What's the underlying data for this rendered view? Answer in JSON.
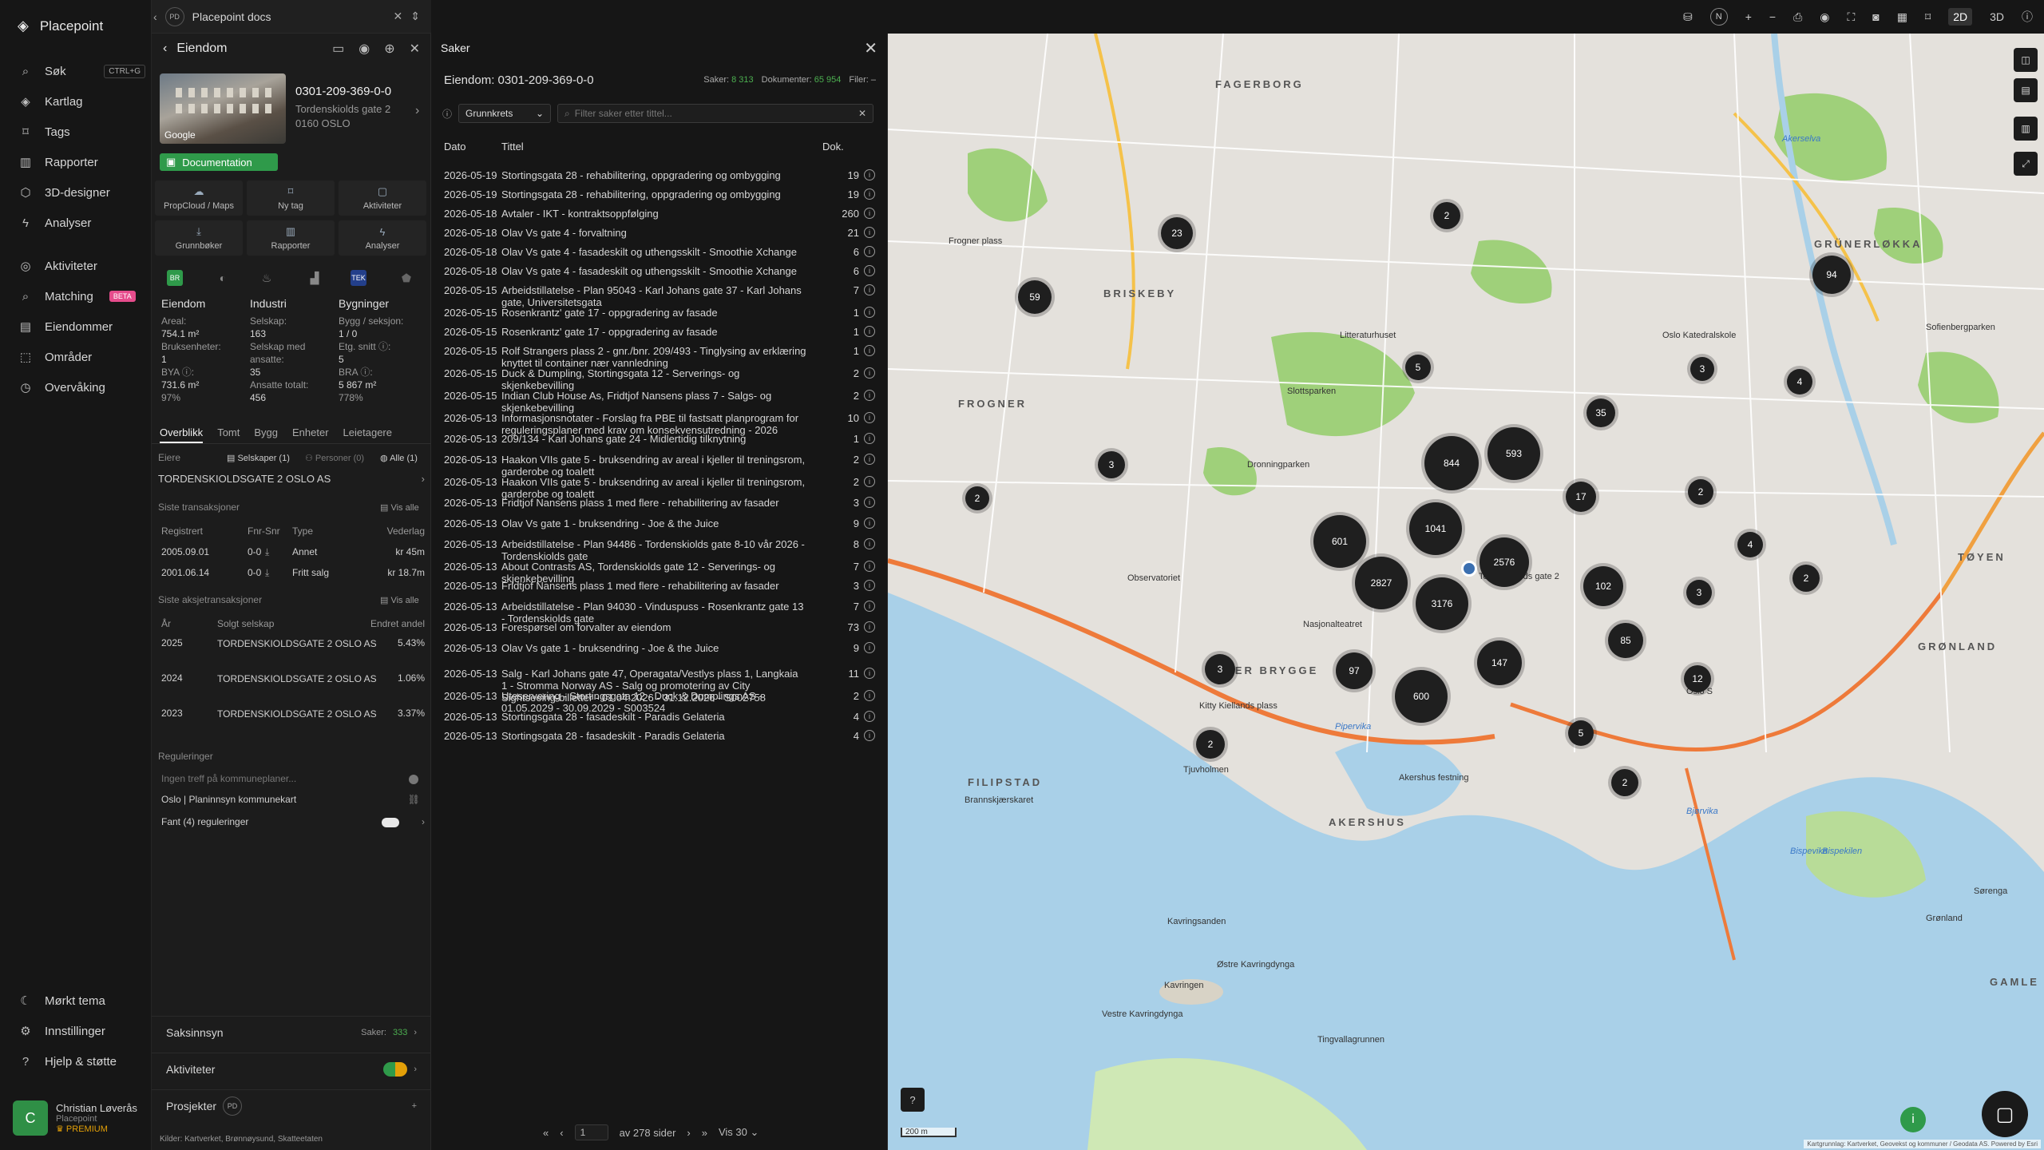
{
  "app": {
    "name": "Placepoint"
  },
  "nav": {
    "items": [
      {
        "label": "Søk",
        "shortcut": "CTRL+G"
      },
      {
        "label": "Kartlag"
      },
      {
        "label": "Tags"
      },
      {
        "label": "Rapporter"
      },
      {
        "label": "3D-designer"
      },
      {
        "label": "Analyser"
      },
      {
        "label": "Aktiviteter"
      },
      {
        "label": "Matching",
        "badge": "BETA"
      },
      {
        "label": "Eiendommer"
      },
      {
        "label": "Områder"
      },
      {
        "label": "Overvåking"
      }
    ],
    "bottom": [
      {
        "label": "Mørkt tema"
      },
      {
        "label": "Innstillinger"
      },
      {
        "label": "Hjelp & støtte"
      }
    ],
    "user": {
      "initial": "C",
      "name": "Christian Løverås",
      "org": "Placepoint",
      "plan": "PREMIUM"
    }
  },
  "doc_tab": {
    "badge": "PD",
    "label": "Placepoint docs"
  },
  "property": {
    "header": "Eiendom",
    "photo_credit": "Google",
    "id": "0301-209-369-0-0",
    "address_line1": "Tordenskiolds gate 2",
    "address_line2": "0160 OSLO",
    "doc_button": "Documentation",
    "tiles": [
      {
        "label": "PropCloud / Maps"
      },
      {
        "label": "Ny tag"
      },
      {
        "label": "Aktiviteter"
      },
      {
        "label": "Grunnbøker"
      },
      {
        "label": "Rapporter"
      },
      {
        "label": "Analyser"
      }
    ],
    "categories": [
      "BR",
      "TEK"
    ],
    "col1": {
      "title": "Eiendom",
      "areal_label": "Areal:",
      "areal": "754.1 m²",
      "bruks_label": "Bruksenheter:",
      "bruks": "1",
      "bya_label": "BYA ⓘ:",
      "bya": "731.6 m²",
      "bya_pct": "97%"
    },
    "col2": {
      "title": "Industri",
      "selskap_label": "Selskap:",
      "selskap": "163",
      "ansatte_label": "Selskap med ansatte:",
      "ansatte": "35",
      "total_label": "Ansatte totalt:",
      "total": "456"
    },
    "col3": {
      "title": "Bygninger",
      "bygg_label": "Bygg / seksjon:",
      "bygg": "1 / 0",
      "etg_label": "Etg. snitt ⓘ:",
      "etg": "5",
      "bra_label": "BRA ⓘ:",
      "bra": "5 867 m²",
      "bra_pct": "778%"
    },
    "subtabs": [
      "Overblikk",
      "Tomt",
      "Bygg",
      "Enheter",
      "Leietagere"
    ],
    "owners": {
      "label": "Eiere",
      "f1": "Selskaper (1)",
      "f2": "Personer (0)",
      "f3": "Alle (1)",
      "name": "TORDENSKIOLDSGATE 2 OSLO AS"
    },
    "transactions": {
      "label": "Siste transaksjoner",
      "see_all": "Vis alle",
      "headers": [
        "Registrert",
        "Fnr-Snr",
        "Type",
        "Vederlag"
      ],
      "rows": [
        {
          "date": "2005.09.01",
          "fnr": "0-0",
          "type": "Annet",
          "amount": "kr 45m"
        },
        {
          "date": "2001.06.14",
          "fnr": "0-0",
          "type": "Fritt salg",
          "amount": "kr 18.7m"
        }
      ]
    },
    "stock": {
      "label": "Siste aksjetransaksjoner",
      "see_all": "Vis alle",
      "headers": [
        "År",
        "Solgt selskap",
        "Endret andel"
      ],
      "rows": [
        {
          "year": "2025",
          "company": "TORDENSKIOLDSGATE 2 OSLO AS",
          "pct": "5.43%"
        },
        {
          "year": "2024",
          "company": "TORDENSKIOLDSGATE 2 OSLO AS",
          "pct": "1.06%"
        },
        {
          "year": "2023",
          "company": "TORDENSKIOLDSGATE 2 OSLO AS",
          "pct": "3.37%"
        }
      ]
    },
    "reg": {
      "label": "Reguleringer",
      "r1": "Ingen treff på kommuneplaner...",
      "r2": "Oslo | Planinnsyn kommunekart",
      "r3": "Fant (4) reguleringer"
    },
    "bottom": {
      "saksinnsyn": "Saksinnsyn",
      "saker_label": "Saker:",
      "saker": "333",
      "aktiviteter": "Aktiviteter",
      "prosjekter": "Prosjekter",
      "pd": "PD"
    },
    "kilder": "Kilder:  Kartverket,  Brønnøysund,  Skatteetaten"
  },
  "cases": {
    "title": "Saker",
    "subtitle": "Eiendom: 0301-209-369-0-0",
    "saker_label": "Saker:",
    "saker": "8 313",
    "dok_label": "Dokumenter:",
    "dok": "65 954",
    "filer_label": "Filer:",
    "filer": "–",
    "select": "Grunnkrets",
    "search_placeholder": "Filter saker etter tittel...",
    "headers": {
      "dato": "Dato",
      "tittel": "Tittel",
      "dok": "Dok."
    },
    "rows": [
      {
        "date": "2026-05-19",
        "title": "Stortingsgata 28 - rehabilitering, oppgradering og ombygging",
        "n": "19"
      },
      {
        "date": "2026-05-19",
        "title": "Stortingsgata 28 - rehabilitering, oppgradering og ombygging",
        "n": "19"
      },
      {
        "date": "2026-05-18",
        "title": "Avtaler - IKT - kontraktsoppfølging",
        "n": "260"
      },
      {
        "date": "2026-05-18",
        "title": "Olav Vs gate 4 - forvaltning",
        "n": "21"
      },
      {
        "date": "2026-05-18",
        "title": "Olav Vs gate 4 - fasadeskilt og uthengsskilt - Smoothie Xchange",
        "n": "6"
      },
      {
        "date": "2026-05-18",
        "title": "Olav Vs gate 4 - fasadeskilt og uthengsskilt - Smoothie Xchange",
        "n": "6"
      },
      {
        "date": "2026-05-15",
        "title": "Arbeidstillatelse - Plan 95043 - Karl Johans gate 37 - Karl Johans gate, Universitetsgata",
        "n": "7"
      },
      {
        "date": "2026-05-15",
        "title": "Rosenkrantz' gate 17 - oppgradering av fasade",
        "n": "1"
      },
      {
        "date": "2026-05-15",
        "title": "Rosenkrantz' gate 17 - oppgradering av fasade",
        "n": "1"
      },
      {
        "date": "2026-05-15",
        "title": "Rolf Strangers plass 2 - gnr./bnr. 209/493 - Tinglysing av erklæring knyttet til container nær vannledning",
        "n": "1"
      },
      {
        "date": "2026-05-15",
        "title": "Duck & Dumpling, Stortingsgata 12 - Serverings- og skjenkebevilling",
        "n": "2"
      },
      {
        "date": "2026-05-15",
        "title": "Indian Club House As, Fridtjof Nansens plass 7 - Salgs- og skjenkebevilling",
        "n": "2"
      },
      {
        "date": "2026-05-13",
        "title": "Informasjonsnotater - Forslag fra PBE til fastsatt planprogram for reguleringsplaner med krav om konsekvensutredning - 2026",
        "n": "10"
      },
      {
        "date": "2026-05-13",
        "title": "209/134 - Karl Johans gate 24 - Midlertidig tilknytning",
        "n": "1"
      },
      {
        "date": "2026-05-13",
        "title": "Haakon VIIs gate 5 - bruksendring av areal i kjeller til treningsrom, garderobe og toalett",
        "n": "2"
      },
      {
        "date": "2026-05-13",
        "title": "Haakon VIIs gate 5 - bruksendring av areal i kjeller til treningsrom, garderobe og toalett",
        "n": "2"
      },
      {
        "date": "2026-05-13",
        "title": "Fridtjof Nansens plass 1 med flere - rehabilitering av fasader",
        "n": "3"
      },
      {
        "date": "2026-05-13",
        "title": "Olav Vs gate 1 - bruksendring - Joe & the Juice",
        "n": "9"
      },
      {
        "date": "2026-05-13",
        "title": "Arbeidstillatelse - Plan 94486 - Tordenskiolds gate 8-10 vår 2026 - Tordenskiolds gate",
        "n": "8"
      },
      {
        "date": "2026-05-13",
        "title": "About Contrasts AS, Tordenskiolds gate 12 - Serverings- og skjenkebevilling",
        "n": "7"
      },
      {
        "date": "2026-05-13",
        "title": "Fridtjof Nansens plass 1 med flere - rehabilitering av fasader",
        "n": "3"
      },
      {
        "date": "2026-05-13",
        "title": "Arbeidstillatelse - Plan 94030 - Vinduspuss - Rosenkrantz gate 13 - Tordenskiolds gate",
        "n": "7"
      },
      {
        "date": "2026-05-13",
        "title": "Forespørsel om forvalter av eiendom",
        "n": "73"
      },
      {
        "date": "2026-05-13",
        "title": "Olav Vs gate 1 - bruksendring - Joe & the Juice",
        "n": "9"
      },
      {
        "date": "2026-05-13",
        "title": "Salg - Karl Johans gate 47, Operagata/Vestlys plass 1, Langkaia 1 - Stromma Norway AS - Salg og promotering av City Sightseeing-billetter - 01.04.2026 - 31.12.2026 - S002758",
        "n": "11"
      },
      {
        "date": "2026-05-13",
        "title": "Uteservering - Stortingsgata 12 - Duck & Dumplings AS - 01.05.2029 - 30.09.2029 - S003524",
        "n": "2"
      },
      {
        "date": "2026-05-13",
        "title": "Stortingsgata 28 - fasadeskilt - Paradis Gelateria",
        "n": "4"
      },
      {
        "date": "2026-05-13",
        "title": "Stortingsgata 28 - fasadeskilt - Paradis Gelateria",
        "n": "4"
      }
    ],
    "pager": {
      "page": "1",
      "of": "av 278 sider",
      "per": "Vis 30"
    }
  },
  "map": {
    "top": {
      "n": "N",
      "d2": "2D",
      "d3": "3D"
    },
    "clusters": [
      {
        "label": "23"
      },
      {
        "label": "59"
      },
      {
        "label": "2"
      },
      {
        "label": "94"
      },
      {
        "label": "5"
      },
      {
        "label": "3"
      },
      {
        "label": "4"
      },
      {
        "label": "35"
      },
      {
        "label": "844"
      },
      {
        "label": "593"
      },
      {
        "label": "3"
      },
      {
        "label": "2"
      },
      {
        "label": "17"
      },
      {
        "label": "2"
      },
      {
        "label": "601"
      },
      {
        "label": "1041"
      },
      {
        "label": "2576"
      },
      {
        "label": "4"
      },
      {
        "label": "2827"
      },
      {
        "label": "3176"
      },
      {
        "label": "102"
      },
      {
        "label": "3"
      },
      {
        "label": "2"
      },
      {
        "label": "85"
      },
      {
        "label": "147"
      },
      {
        "label": "3"
      },
      {
        "label": "97"
      },
      {
        "label": "600"
      },
      {
        "label": "12"
      },
      {
        "label": "5"
      },
      {
        "label": "2"
      },
      {
        "label": "2"
      }
    ],
    "labels": [
      "FAGERBORG",
      "BRISKEBY",
      "GRÜNERLØKKA",
      "FROGNER",
      "TØYEN",
      "GRØNLAND",
      "AKER BRYGGE",
      "FILIPSTAD",
      "AKERSHUS",
      "GAMLE",
      "Akerselva",
      "Frogner plass",
      "Slottsparken",
      "Litteraturhuset",
      "Oslo Katedralskole",
      "Pipervika",
      "Kavringsanden",
      "Østre Kavringdynga",
      "Vestre Kavringdynga",
      "Kavringen",
      "Tingvallagrunnen",
      "Bjørvika",
      "Bispevika",
      "Bispekilen",
      "Oslo S",
      "Nasjonalteatret",
      "Kitty Kiellands plass",
      "Tjuvholmen",
      "Brannskjærskaret",
      "Akershus festning",
      "Observatoriet",
      "Dronningparken",
      "Sofienbergparken",
      "Sørenga",
      "Grønland",
      "Tordenskiolds gate 2"
    ],
    "scale": "200 m",
    "attribution": "Kartgrunnlag: Kartverket, Geovekst og kommuner / Geodata AS. Powered by Esri"
  }
}
